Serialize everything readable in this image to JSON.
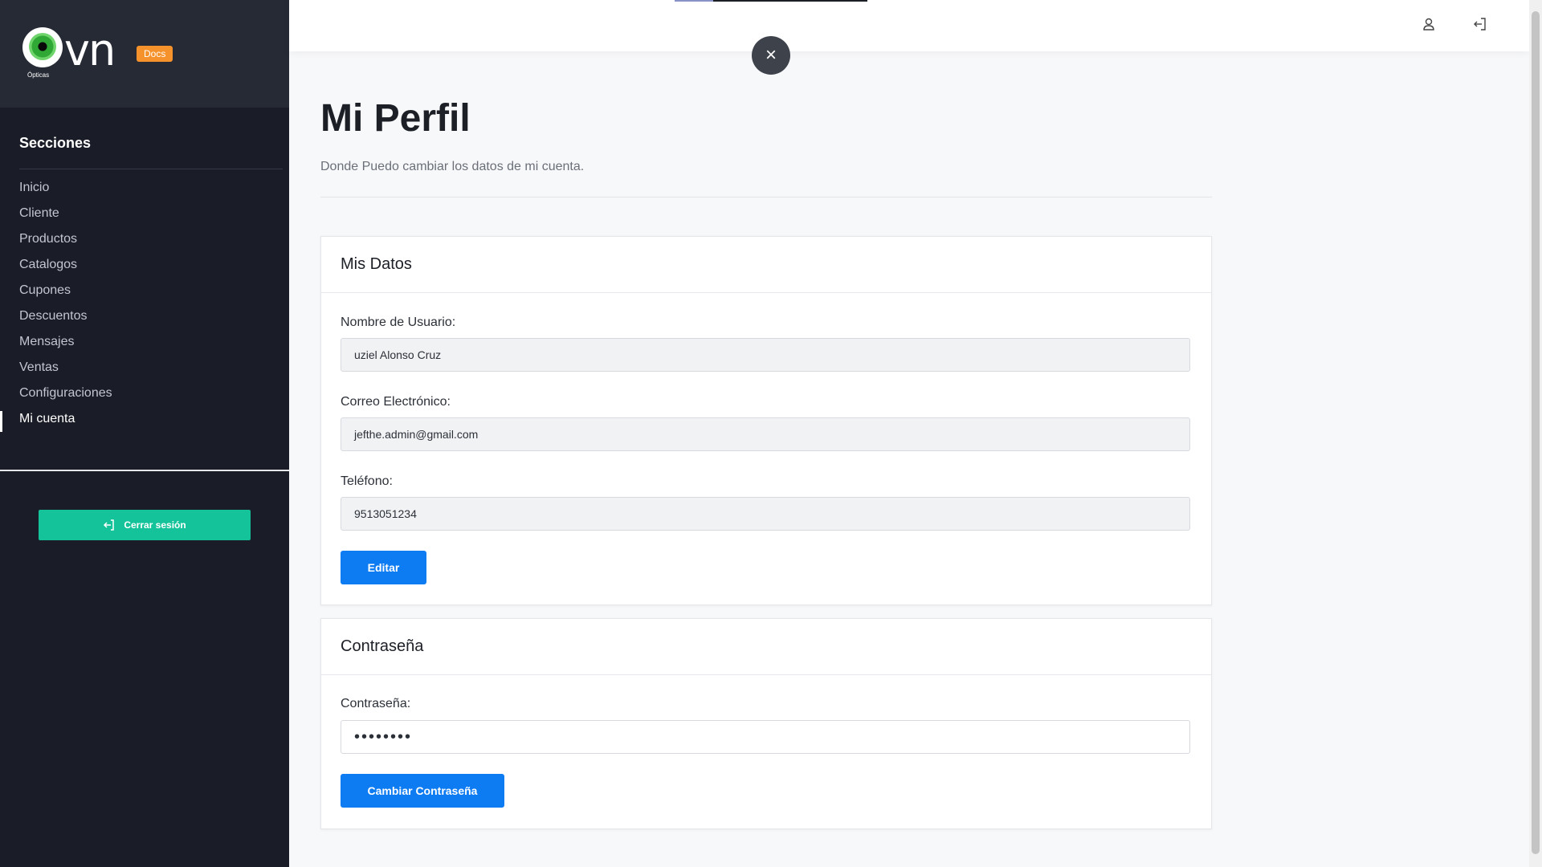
{
  "sidebar": {
    "logo_text": "vn",
    "logo_subtext": "Ópticas",
    "docs_badge": "Docs",
    "sections_title": "Secciones",
    "items": [
      {
        "label": "Inicio"
      },
      {
        "label": "Cliente"
      },
      {
        "label": "Productos"
      },
      {
        "label": "Catalogos"
      },
      {
        "label": "Cupones"
      },
      {
        "label": "Descuentos"
      },
      {
        "label": "Mensajes"
      },
      {
        "label": "Ventas"
      },
      {
        "label": "Configuraciones"
      },
      {
        "label": "Mi cuenta",
        "active": true
      }
    ],
    "logout_label": "Cerrar sesión"
  },
  "topbar": {
    "icons": [
      "user-icon",
      "logout-icon"
    ]
  },
  "overlay": {
    "close_symbol": "×"
  },
  "main": {
    "title": "Mi Perfil",
    "subtitle": "Donde Puedo cambiar los datos de mi cuenta.",
    "datos_card": {
      "title": "Mis Datos",
      "username_label": "Nombre de Usuario:",
      "username_value": "uziel Alonso Cruz",
      "email_label": "Correo Electrónico:",
      "email_value": "jefthe.admin@gmail.com",
      "phone_label": "Teléfono:",
      "phone_value": "9513051234",
      "edit_button": "Editar"
    },
    "password_card": {
      "title": "Contraseña",
      "password_label": "Contraseña:",
      "password_value": "••••••••",
      "change_button": "Cambiar Contraseña"
    }
  },
  "colors": {
    "sidebar_bg": "#1a1d27",
    "sidebar_top_bg": "#262a35",
    "accent_green": "#15c39b",
    "docs_orange": "#f5922b",
    "primary_blue": "#0d7bf2"
  }
}
